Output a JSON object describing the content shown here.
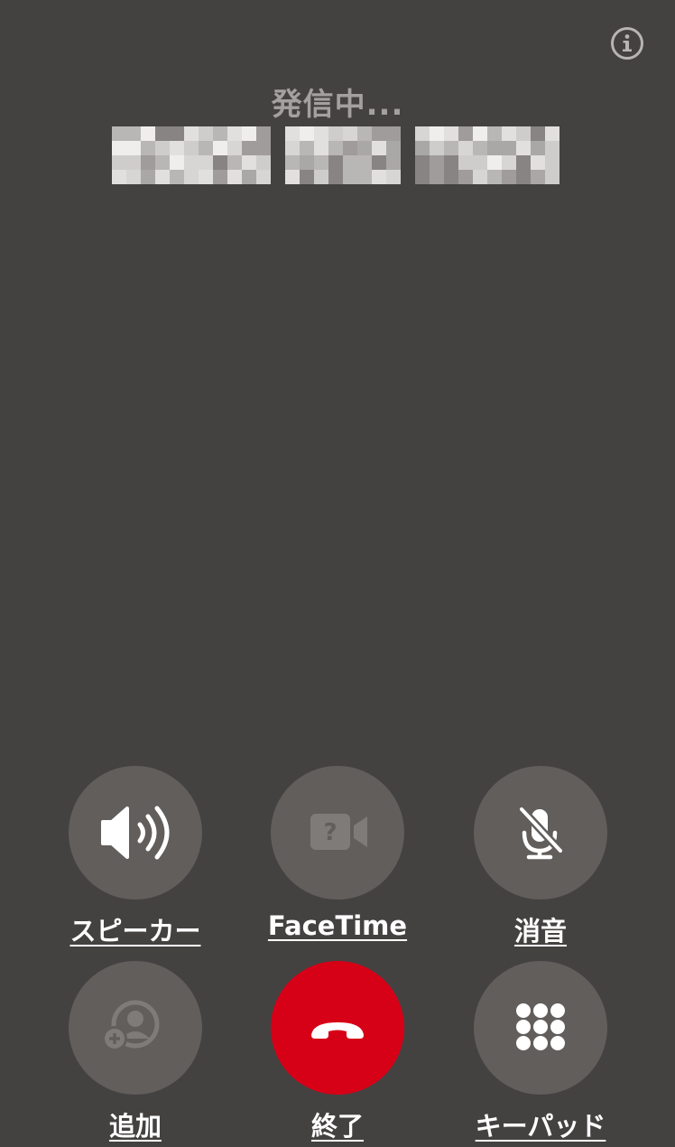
{
  "call": {
    "status": "発信中..."
  },
  "controls": {
    "speaker_label": "スピーカー",
    "facetime_label": "FaceTime",
    "mute_label": "消音",
    "add_label": "追加",
    "end_label": "終了",
    "keypad_label": "キーパッド"
  },
  "icons": {
    "info": "info-icon",
    "speaker": "speaker-wave-icon",
    "facetime": "video-question-icon",
    "mute": "microphone-slash-icon",
    "add": "add-person-icon",
    "end": "phone-down-icon",
    "keypad": "keypad-grid-icon"
  },
  "colors": {
    "background": "#444141",
    "button": "#615e5c",
    "end_button": "#d60017",
    "status_text": "#a3a09f",
    "label_text": "#ffffff"
  }
}
